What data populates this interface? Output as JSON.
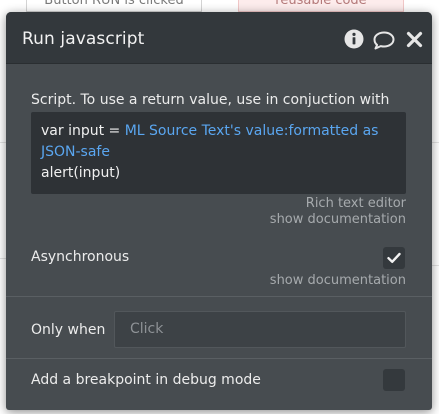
{
  "background": {
    "left_card_label": "Button RUN is clicked",
    "right_card_label": "reusable code"
  },
  "panel": {
    "title": "Run javascript",
    "icons": [
      "info-icon",
      "comment-icon",
      "close-icon"
    ]
  },
  "script": {
    "label": "Script. To use a return value, use in conjuction with",
    "code_line1_plain": "var input = ",
    "code_line1_dynamic": "ML Source Text's value:formatted as",
    "code_line2_dynamic": "JSON-safe",
    "code_line3": "alert(input)",
    "editor_hint": "Rich text editor",
    "doc_link": "show documentation"
  },
  "asynchronous": {
    "label": "Asynchronous",
    "checked": true,
    "doc_link": "show documentation"
  },
  "only_when": {
    "label": "Only when",
    "placeholder": "Click"
  },
  "breakpoint": {
    "label": "Add a breakpoint in debug mode",
    "checked": false
  },
  "colors": {
    "panel_bg": "#474c50",
    "titlebar_bg": "#33383c",
    "code_bg": "#2e3236",
    "dynamic_expression": "#5aa6f0"
  }
}
